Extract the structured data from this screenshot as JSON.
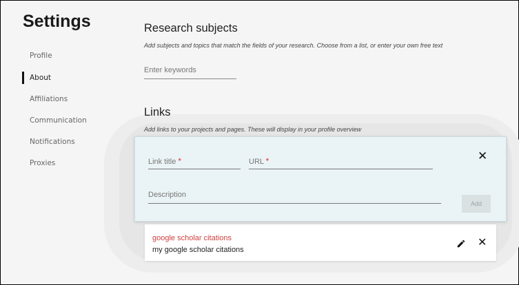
{
  "sidebar": {
    "title": "Settings",
    "items": [
      {
        "label": "Profile"
      },
      {
        "label": "About"
      },
      {
        "label": "Affiliations"
      },
      {
        "label": "Communication"
      },
      {
        "label": "Notifications"
      },
      {
        "label": "Proxies"
      }
    ],
    "active_item": "About"
  },
  "research": {
    "heading": "Research subjects",
    "subtitle": "Add subjects and topics that match the fields of your research. Choose from a list, or enter your own free text",
    "keywords_placeholder": "Enter keywords"
  },
  "links": {
    "heading": "Links",
    "subtitle": "Add links to your projects and pages. These will display in your profile overview",
    "form": {
      "link_title_placeholder": "Link title",
      "url_placeholder": "URL",
      "required_marker": "*",
      "description_placeholder": "Description",
      "add_label": "Add",
      "close_glyph": "✕"
    },
    "items": [
      {
        "title": "google scholar citations",
        "description": "my google scholar citations",
        "close_glyph": "✕"
      }
    ]
  },
  "colors": {
    "link_title": "#d04040",
    "required": "#d33333",
    "form_bg": "#eaf3f5"
  }
}
